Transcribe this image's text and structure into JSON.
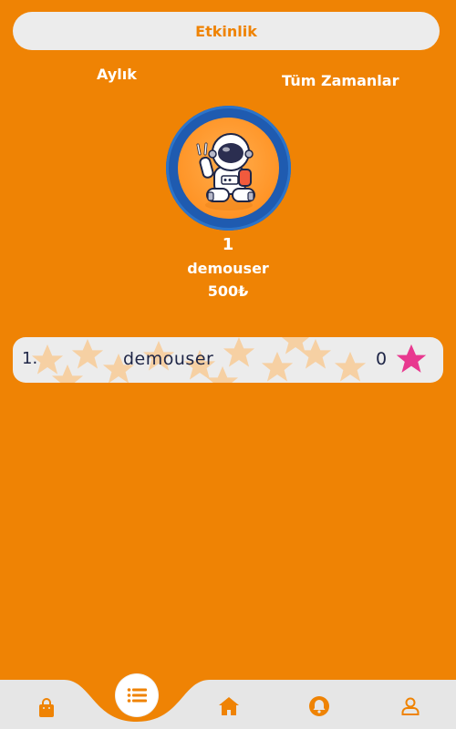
{
  "header": {
    "title": "Etkinlik"
  },
  "tabs": {
    "monthly": "Aylık",
    "all_time": "Tüm Zamanlar"
  },
  "top_user": {
    "rank": "1",
    "name": "demouser",
    "score": "500₺"
  },
  "leaderboard": [
    {
      "index": "1.",
      "name": "demouser",
      "score": "0"
    }
  ],
  "colors": {
    "background": "#ef8304",
    "pill": "#ececec",
    "text_dark": "#1e2546",
    "star_pink": "#e8388f",
    "ring_blue": "#1f5bb0"
  },
  "bottom_nav": {
    "items": [
      "shopping-bag-icon",
      "list-icon",
      "home-icon",
      "bell-icon",
      "user-icon"
    ]
  }
}
